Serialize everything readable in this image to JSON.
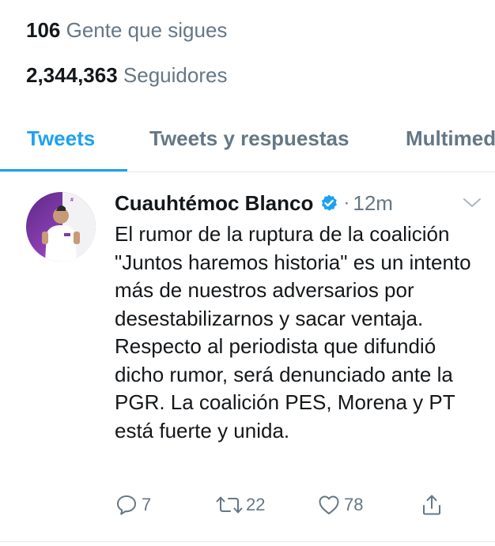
{
  "stats": {
    "following_count": "106",
    "following_label": "Gente que sigues",
    "followers_count": "2,344,363",
    "followers_label": "Seguidores"
  },
  "tabs": [
    {
      "label": "Tweets",
      "active": true
    },
    {
      "label": "Tweets y respuestas",
      "active": false
    },
    {
      "label": "Multimedia",
      "active": false
    }
  ],
  "tweet": {
    "author_name": "Cuauhtémoc Blanco",
    "verified": true,
    "separator": "·",
    "time": "12m",
    "avatar_icon": "profile-photo",
    "text": "El rumor de la ruptura de la coalición \"Juntos haremos historia\" es un intento más de nuestros adversarios por desestabilizarnos y sacar ventaja. Respecto al periodista que difundió dicho rumor, será denunciado ante la PGR. La coalición PES, Morena y PT está fuerte y unida.",
    "reply_count": "7",
    "retweet_count": "22",
    "like_count": "78"
  },
  "colors": {
    "accent": "#1da1f2",
    "secondary_text": "#657786",
    "primary_text": "#14171a",
    "divider": "#e1e8ed"
  }
}
